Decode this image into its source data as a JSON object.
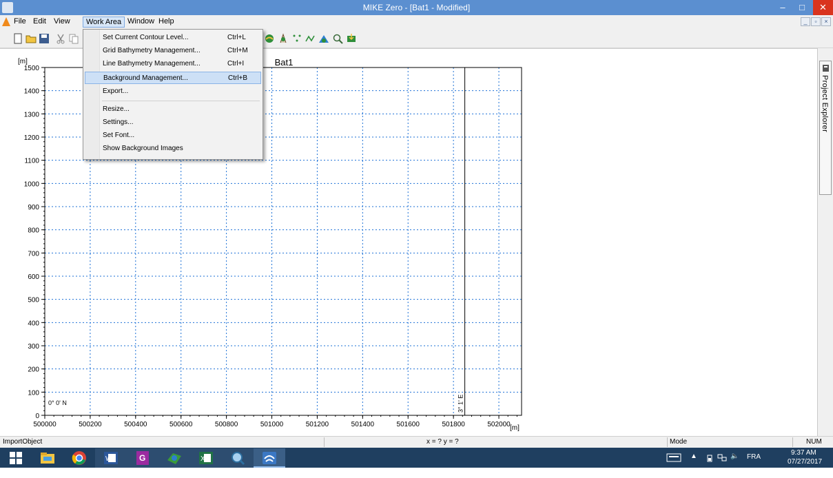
{
  "window": {
    "title": "MIKE Zero - [Bat1 - Modified]",
    "minimize": "–",
    "maximize": "□",
    "close": "✕"
  },
  "menubar": {
    "items": [
      "File",
      "Edit",
      "View",
      "Work Area",
      "Window",
      "Help"
    ],
    "active": "Work Area",
    "mdi_minimize": "_",
    "mdi_restore": "▫",
    "mdi_close": "×"
  },
  "toolbar": {
    "icons": [
      "new-icon",
      "open-icon",
      "save-icon",
      "cut-icon",
      "copy-icon",
      "bathymetry-icon",
      "contour-icon",
      "points-icon",
      "line-icon",
      "background-icon",
      "zoom-icon",
      "import-icon"
    ]
  },
  "work_area_menu": {
    "items": [
      {
        "label": "Set Current Contour Level...",
        "accel": "Ctrl+L"
      },
      {
        "label": "Grid Bathymetry Management...",
        "accel": "Ctrl+M"
      },
      {
        "label": "Line Bathymetry Management...",
        "accel": "Ctrl+I"
      },
      {
        "label": "Background Management...",
        "accel": "Ctrl+B",
        "highlighted": true
      },
      {
        "label": "Export...",
        "accel": ""
      },
      {
        "label": "Resize...",
        "accel": ""
      },
      {
        "label": "Settings...",
        "accel": ""
      },
      {
        "label": "Set Font...",
        "accel": ""
      },
      {
        "label": "Show Background Images",
        "accel": ""
      }
    ]
  },
  "chart_data": {
    "type": "scatter",
    "title": "Bat1",
    "xlabel": "[m]",
    "ylabel": "[m]",
    "xlim": [
      500000,
      502100
    ],
    "ylim": [
      0,
      1500
    ],
    "x_ticks": [
      500000,
      500200,
      500400,
      500600,
      500800,
      501000,
      501200,
      501400,
      501600,
      501800,
      502000
    ],
    "y_ticks": [
      0,
      100,
      200,
      300,
      400,
      500,
      600,
      700,
      800,
      900,
      1000,
      1100,
      1200,
      1300,
      1400,
      1500
    ],
    "grid": true,
    "annotations": [
      {
        "text": "0° 0' N",
        "x": 500000,
        "y": 40
      },
      {
        "text": "3° 1' E",
        "x": 501850,
        "y": 100
      }
    ],
    "vertical_line": {
      "x": 501850
    },
    "series": []
  },
  "statusbar": {
    "left": "ImportObject",
    "center": "x = ? y = ?",
    "mode": "Mode",
    "num": "NUM"
  },
  "side_panel": {
    "tab_label": "Project Explorer"
  },
  "taskbar": {
    "apps": [
      "start-icon",
      "file-explorer-icon",
      "chrome-icon",
      "word-icon",
      "pdf-icon",
      "mike-zone-icon",
      "excel-icon",
      "search-app-icon",
      "mike-zero-icon"
    ],
    "lang": "FRA",
    "time": "9:37 AM",
    "date": "07/27/2017"
  },
  "colors": {
    "titlebar": "#5b8fd0",
    "grid": "#1a6fd6",
    "taskbar": "#1f3f60",
    "menu_highlight": "#cde0f6"
  }
}
